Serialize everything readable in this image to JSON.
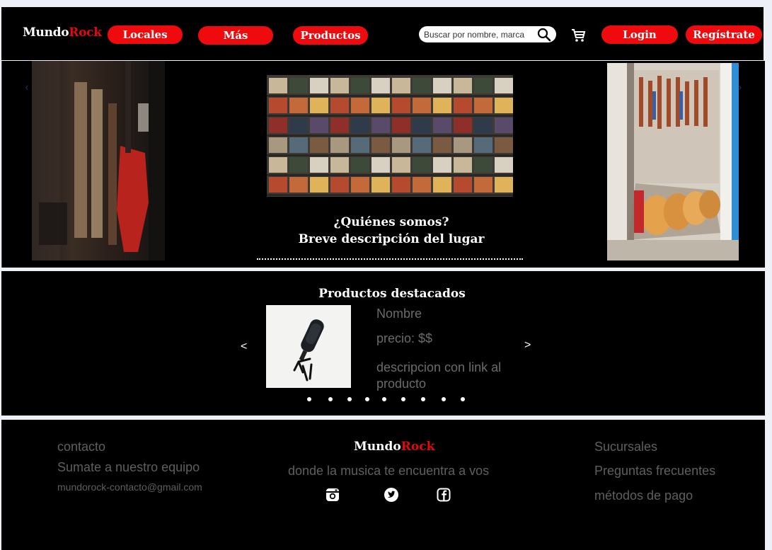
{
  "header": {
    "logo": {
      "part1": "Mundo",
      "part2": "Rock"
    },
    "nav": [
      {
        "label": "Locales"
      },
      {
        "label": "Más"
      },
      {
        "label": "Productos"
      }
    ],
    "search": {
      "placeholder": "Buscar por nombre, marca",
      "icon": "search-icon"
    },
    "cart_icon": "cart-icon",
    "login_label": "Login",
    "register_label": "Regístrate"
  },
  "hero": {
    "title_line1": "¿Quiénes somos?",
    "title_line2": "Breve descripción del lugar"
  },
  "featured": {
    "title": "Productos destacados",
    "product": {
      "name": "Nombre",
      "price": "precio: $$",
      "description": "descripcion con link al producto"
    },
    "prev_arrow": "<",
    "next_arrow": ">",
    "dot_count": 9
  },
  "footer": {
    "left": {
      "contact": "contacto",
      "join": "Sumate a nuestro equipo",
      "email": "mundorock-contacto@gmail.com"
    },
    "center": {
      "logo": {
        "part1": "Mundo",
        "part2": "Rock"
      },
      "tagline": "donde la musica te encuentra a vos",
      "social": [
        "instagram-icon",
        "twitter-icon",
        "facebook-icon"
      ]
    },
    "right": {
      "branches": "Sucursales",
      "faq": "Preguntas frecuentes",
      "payments": "métodos de pago"
    }
  },
  "colors": {
    "accent": "#ef0b0d",
    "background": "#000000",
    "muted_text": "#5f5f5f"
  }
}
